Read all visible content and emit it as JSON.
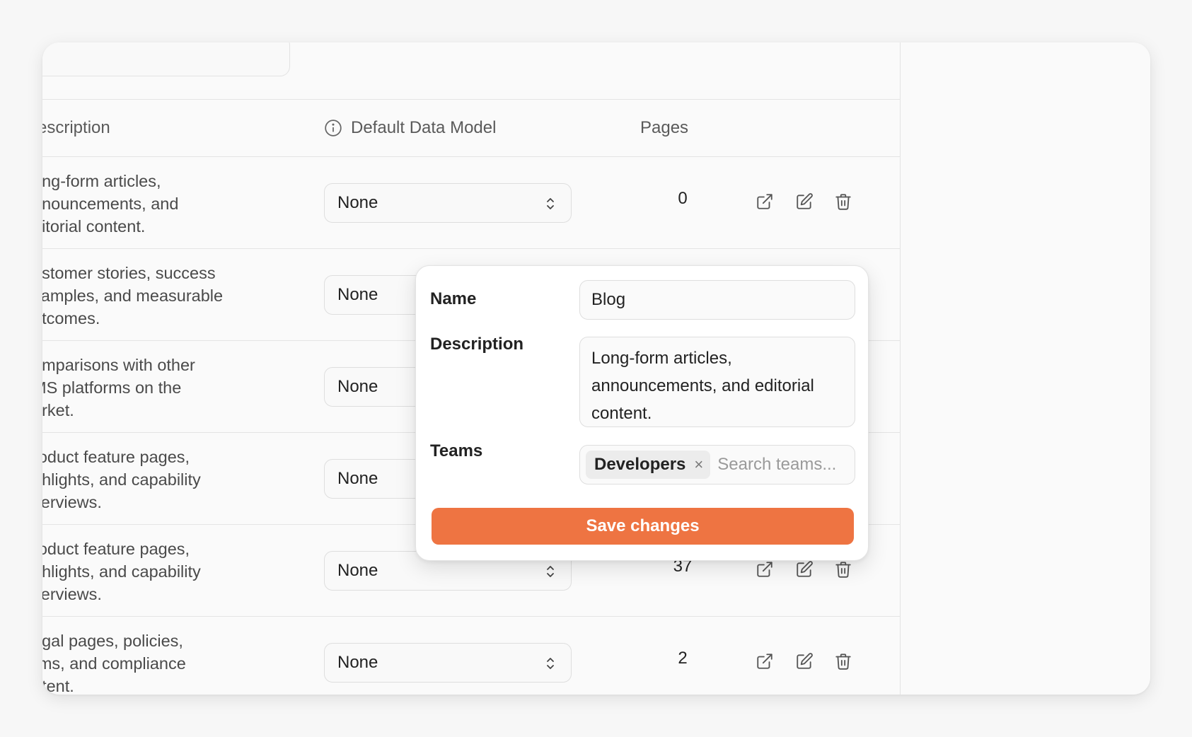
{
  "table": {
    "headers": {
      "description": "escription",
      "default_data_model": "Default Data Model",
      "pages": "Pages"
    },
    "rows": [
      {
        "description": "ong-form articles,\nnnouncements, and\nditorial content.",
        "model": "None",
        "pages": "0"
      },
      {
        "description": "ustomer stories, success\nxamples, and measurable\nutcomes.",
        "model": "None",
        "pages": ""
      },
      {
        "description": "omparisons with other\nMS platforms on the\narket.",
        "model": "None",
        "pages": ""
      },
      {
        "description": "roduct feature pages,\nghlights, and capability\nverviews.",
        "model": "None",
        "pages": ""
      },
      {
        "description": "roduct feature pages,\nghlights, and capability\nverviews.",
        "model": "None",
        "pages": "37"
      },
      {
        "description": "egal pages, policies,\nrms, and compliance\nntent.",
        "model": "None",
        "pages": "2"
      }
    ]
  },
  "popover": {
    "name_label": "Name",
    "name_value": "Blog",
    "description_label": "Description",
    "description_value": "Long-form articles, announcements, and editorial content.",
    "teams_label": "Teams",
    "teams_chip": "Developers",
    "teams_remove": "×",
    "teams_placeholder": "Search teams...",
    "save_label": "Save changes"
  },
  "colors": {
    "accent": "#ee7442",
    "background": "#f7f7f7",
    "panel": "#fafafa"
  },
  "icons": [
    "info-icon",
    "chevron-updown-icon",
    "external-link-icon",
    "edit-icon",
    "trash-icon",
    "close-icon"
  ]
}
